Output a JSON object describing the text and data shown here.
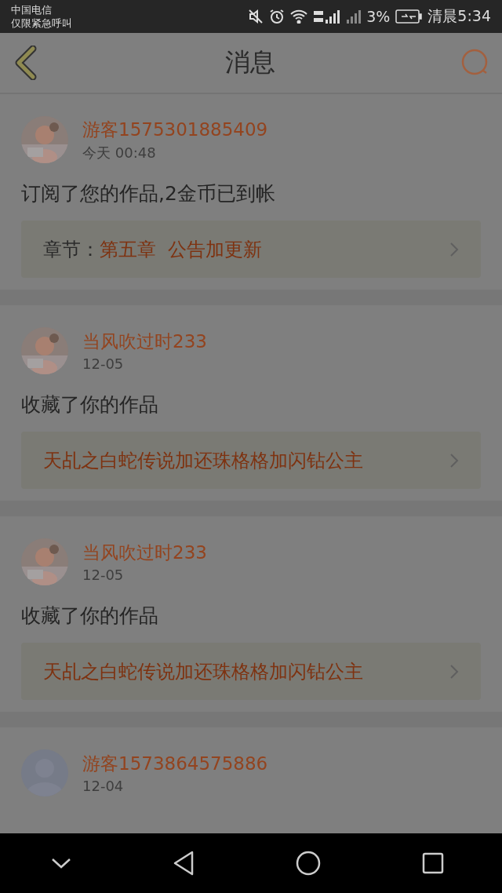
{
  "status_bar": {
    "carrier": "中国电信",
    "carrier_note": "仅限紧急呼叫",
    "battery_text": "3%",
    "time": "清晨5:34"
  },
  "header": {
    "title": "消息"
  },
  "messages": [
    {
      "user": "游客1575301885409",
      "time": "今天 00:48",
      "text": "订阅了您的作品,2金币已到帐",
      "link": {
        "label": "章节：",
        "title": "第五章  公告加更新"
      }
    },
    {
      "user": "当风吹过时233",
      "time": "12-05",
      "text": "收藏了你的作品",
      "link": {
        "title": "天乩之白蛇传说加还珠格格加闪钻公主"
      }
    },
    {
      "user": "当风吹过时233",
      "time": "12-05",
      "text": "收藏了你的作品",
      "link": {
        "title": "天乩之白蛇传说加还珠格格加闪钻公主"
      }
    },
    {
      "avatar": {
        "kind": "default"
      },
      "user": "游客1573864575886",
      "time": "12-04"
    }
  ]
}
